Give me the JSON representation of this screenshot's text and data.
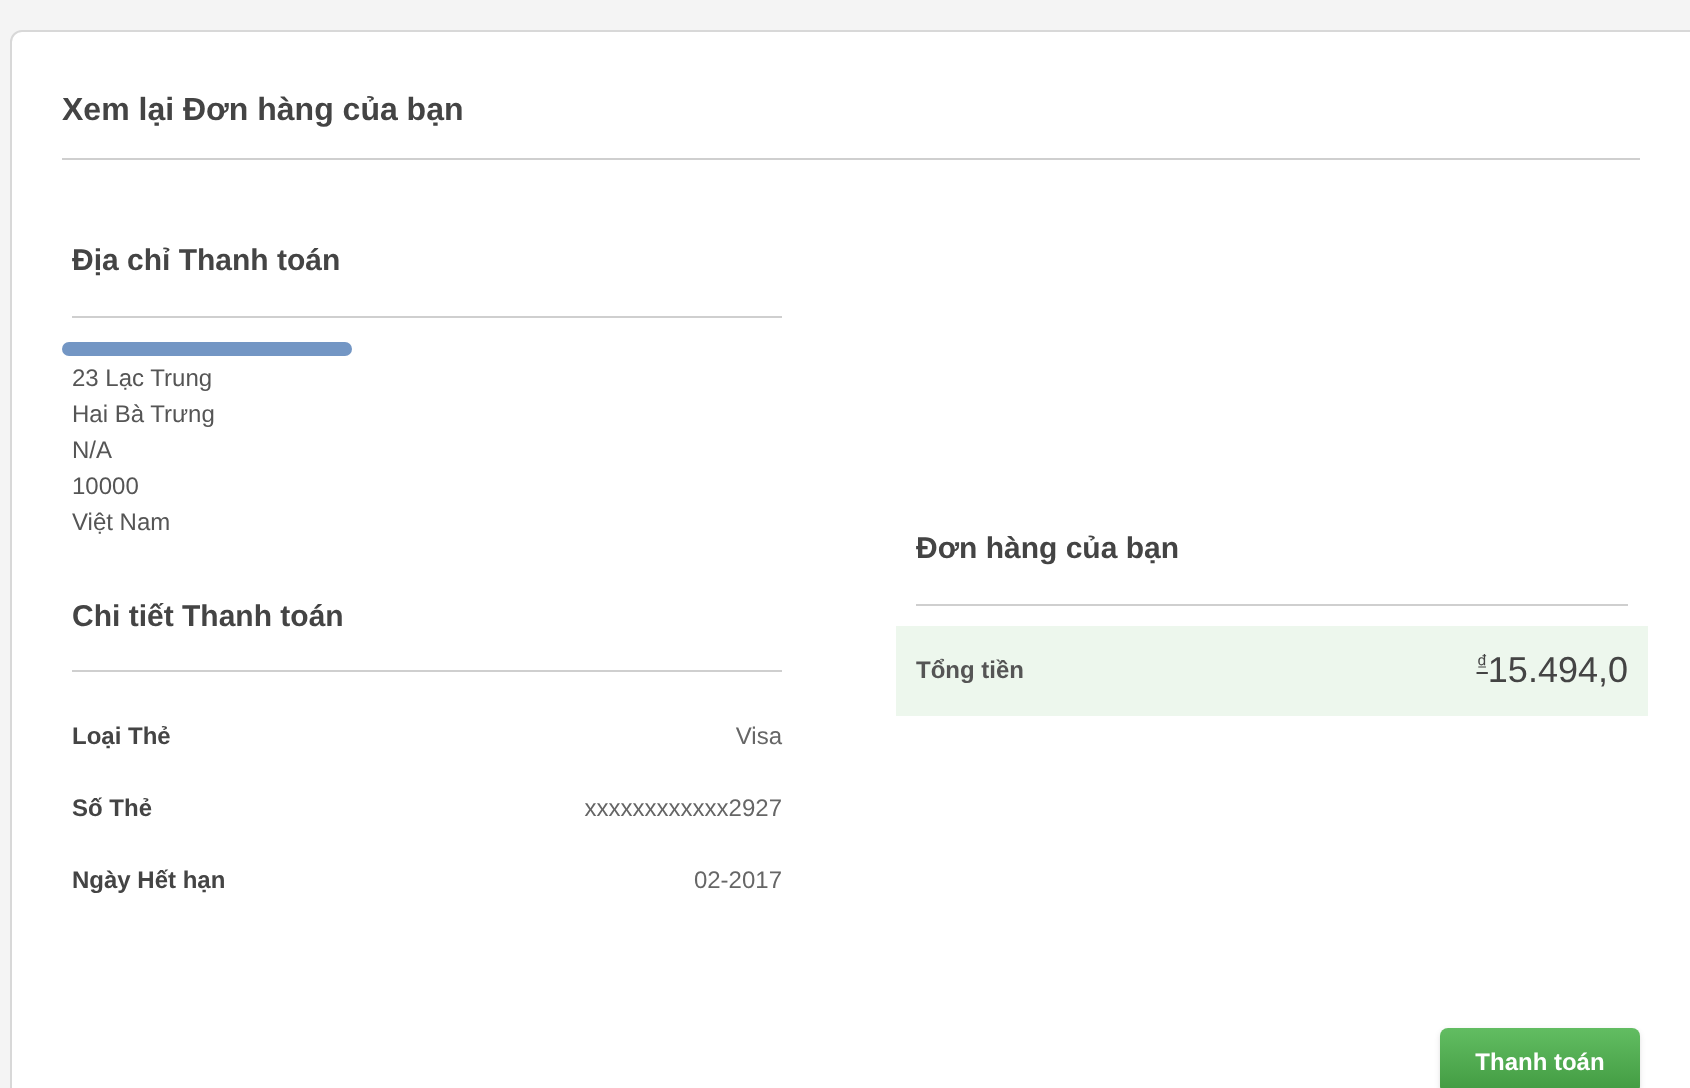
{
  "title": "Xem lại Đơn hàng của bạn",
  "billing_address": {
    "heading": "Địa chỉ Thanh toán",
    "name_redacted": true,
    "lines": [
      "23 Lạc Trung",
      "Hai Bà Trưng",
      "N/A",
      "10000",
      "Việt Nam"
    ]
  },
  "payment_details": {
    "heading": "Chi tiết Thanh toán",
    "rows": [
      {
        "label": "Loại Thẻ",
        "value": "Visa"
      },
      {
        "label": "Số Thẻ",
        "value": "xxxxxxxxxxxx2927"
      },
      {
        "label": "Ngày Hết hạn",
        "value": "02-2017"
      }
    ]
  },
  "order": {
    "heading": "Đơn hàng của bạn",
    "total_label": "Tổng tiền",
    "currency": "₫",
    "total": "15.494,0"
  },
  "submit_button": "Thanh toán"
}
